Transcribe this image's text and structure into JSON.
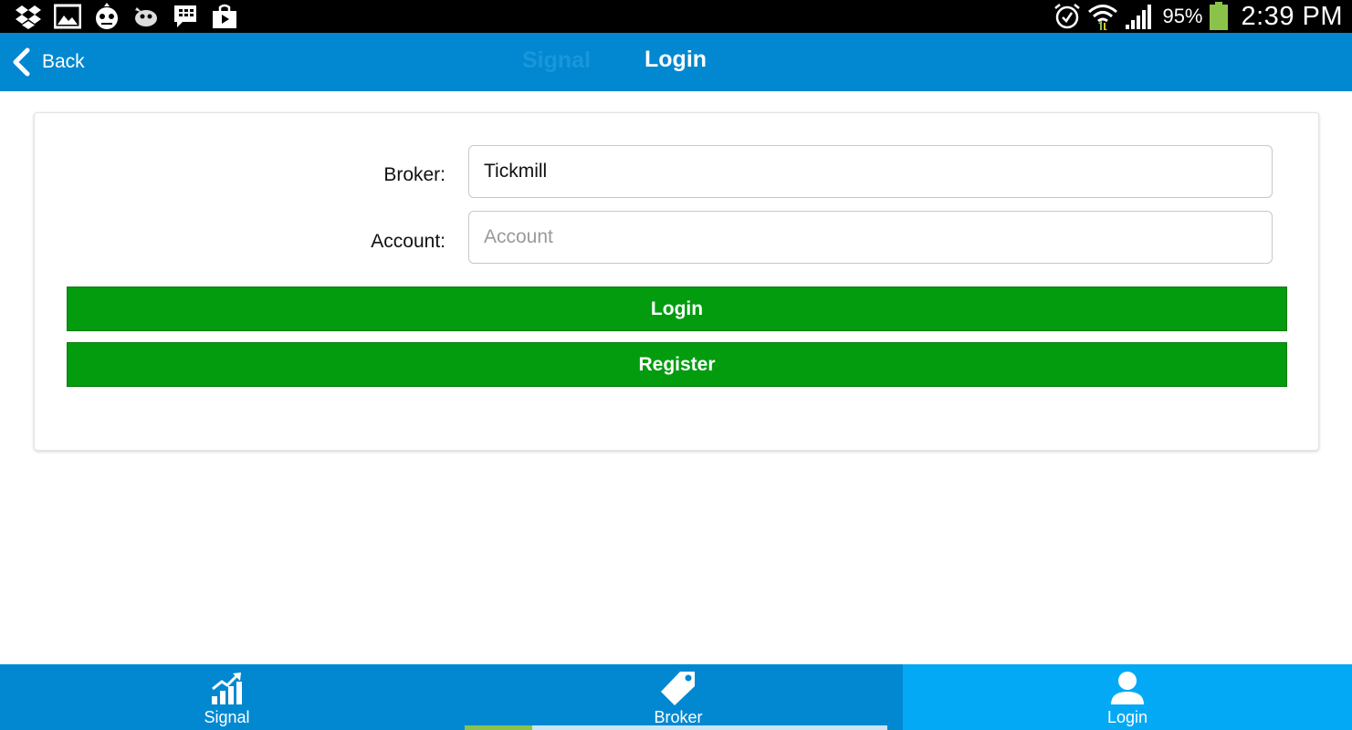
{
  "status_bar": {
    "left_icons": [
      "dropbox-icon",
      "gallery-icon",
      "game-icon",
      "bird-icon",
      "bbm-icon",
      "store-icon"
    ],
    "right_icons": [
      "alarm-icon",
      "wifi-icon",
      "signal-icon",
      "battery-icon"
    ],
    "battery_percent": "95%",
    "time": "2:39 PM"
  },
  "header": {
    "back_label": "Back",
    "ghost_title": "Signal",
    "title": "Login",
    "background": "#0288d1"
  },
  "form": {
    "broker_label": "Broker:",
    "broker_value": "Tickmill",
    "account_label": "Account:",
    "account_placeholder": "Account",
    "account_value": "",
    "login_button": "Login",
    "register_button": "Register",
    "button_color": "#039c0f"
  },
  "bottom_nav": {
    "items": [
      {
        "label": "Signal",
        "icon": "chart-growth-icon",
        "active": false
      },
      {
        "label": "Broker",
        "icon": "tag-icon",
        "active": false
      },
      {
        "label": "Login",
        "icon": "user-icon",
        "active": true
      }
    ],
    "active_color": "#03a9f4"
  }
}
